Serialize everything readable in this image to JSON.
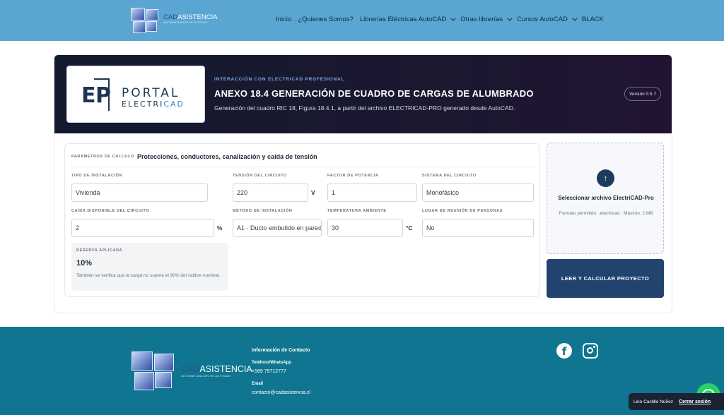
{
  "header": {
    "logo": {
      "brand_a": "CAD",
      "brand_b": "ASISTENCIA",
      "tagline": "AUTOMATIZACIÓN DE AUTOCAD"
    },
    "nav": [
      {
        "label": "Inicio",
        "dropdown": false
      },
      {
        "label": "¿Quienes Somos?",
        "dropdown": false
      },
      {
        "label": "Librerías Eléctricas AutoCAD",
        "dropdown": true
      },
      {
        "label": "Otras librerías",
        "dropdown": true
      },
      {
        "label": "Cursos AutoCAD",
        "dropdown": true
      },
      {
        "label": "BLACK",
        "dropdown": false
      }
    ]
  },
  "hero": {
    "portal_logo": {
      "portal": "PORTAL",
      "electri": "ELECTRI",
      "cad": "CAD"
    },
    "kicker": "INTERACCIÓN CON ELECTRICAD PROFESIONAL",
    "title": "ANEXO 18.4 GENERACIÓN DE CUADRO DE CARGAS DE ALUMBRADO",
    "subtitle": "Generación del cuadro RIC 18, Figura 18.4.1, a partir del archivo ELECTRICAD-PRO generado desde AutoCAD.",
    "version": "Versión 0.5.7"
  },
  "params": {
    "kicker": "PARÁMETROS DE CÁLCULO",
    "title": "Protecciones, conductores, canalización y caída de tensión",
    "fields": {
      "tipo_instalacion": {
        "label": "TIPO DE INSTALACIÓN",
        "value": "Vivienda"
      },
      "tension": {
        "label": "TENSIÓN DEL CIRCUITO",
        "value": "220",
        "unit": "V"
      },
      "factor_potencia": {
        "label": "FACTOR DE POTENCIA",
        "value": "1"
      },
      "sistema": {
        "label": "SISTEMA DEL CIRCUITO",
        "value": "Monofásico"
      },
      "caida": {
        "label": "CAÍDA DISPONIBLE DEL CIRCUITO",
        "value": "2",
        "unit": "%"
      },
      "metodo": {
        "label": "MÉTODO DE INSTALACIÓN",
        "value": "A1 · Ducto embutido en pared"
      },
      "temperatura": {
        "label": "TEMPERATURA AMBIENTE",
        "value": "30",
        "unit": "°C"
      },
      "reunion": {
        "label": "LUGAR DE REUNIÓN DE PERSONAS",
        "value": "No"
      }
    },
    "reserve": {
      "label": "RESERVA APLICADA",
      "value": "10%",
      "note": "También se verifica que la carga no supere el 90% del calibre nominal."
    }
  },
  "upload": {
    "title": "Seleccionar archivo ElectriCAD-Pro",
    "note": "Formato permitido: .electricad · Máximo: 2 MB"
  },
  "calc_button": "LEER Y CALCULAR PROYECTO",
  "footer": {
    "contact_title": "Información de Contacto",
    "phone_label": "Teléfono/WhatsApp",
    "phone": "+569 79712777",
    "email_label": "Email",
    "email": "contacto@cadasistencia.cl"
  },
  "session": {
    "user": "Lino Castillo Núñez",
    "logout": "Cerrar sesión"
  },
  "colors": {
    "nav_bg": "#5aa6d2",
    "hero_bg": "#1b1830",
    "button": "#22436e",
    "footer_bg": "#0f7590",
    "whatsapp": "#25d366"
  }
}
